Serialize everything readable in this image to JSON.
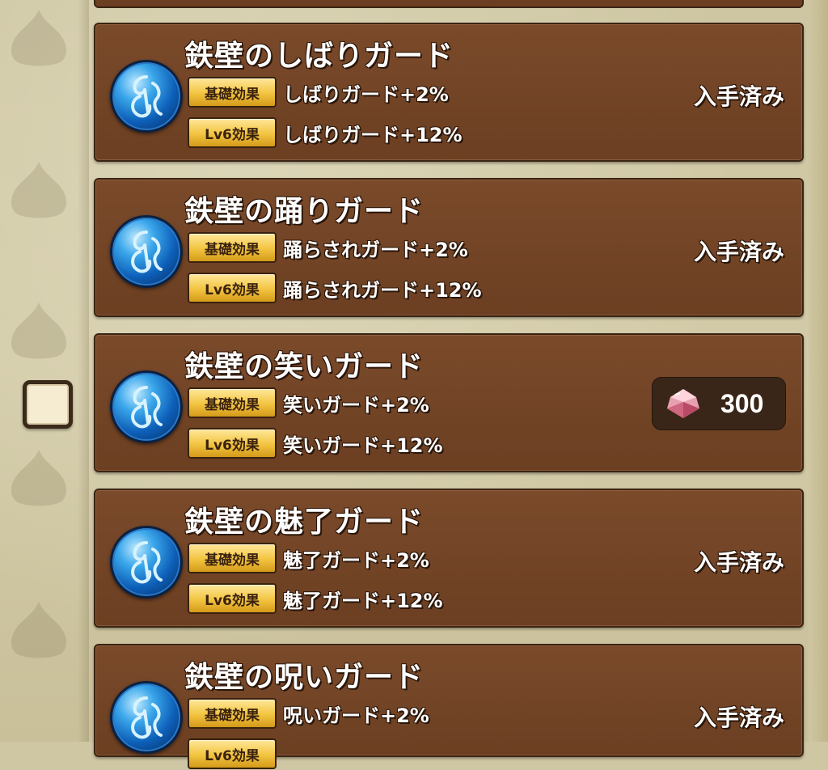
{
  "skills": [
    {
      "title": "鉄壁のしばりガード",
      "base_tag": "基礎効果",
      "base_effect": "しばりガード+2%",
      "lv_tag": "Lv6効果",
      "lv_effect": "しばりガード+12%",
      "status": "入手済み",
      "acquired": true,
      "icon": "guard-orb-icon"
    },
    {
      "title": "鉄壁の踊りガード",
      "base_tag": "基礎効果",
      "base_effect": "踊らされガード+2%",
      "lv_tag": "Lv6効果",
      "lv_effect": "踊らされガード+12%",
      "status": "入手済み",
      "acquired": true,
      "icon": "guard-orb-icon"
    },
    {
      "title": "鉄壁の笑いガード",
      "base_tag": "基礎効果",
      "base_effect": "笑いガード+2%",
      "lv_tag": "Lv6効果",
      "lv_effect": "笑いガード+12%",
      "acquired": false,
      "price": "300",
      "price_icon": "gem-icon",
      "icon": "guard-orb-icon"
    },
    {
      "title": "鉄壁の魅了ガード",
      "base_tag": "基礎効果",
      "base_effect": "魅了ガード+2%",
      "lv_tag": "Lv6効果",
      "lv_effect": "魅了ガード+12%",
      "status": "入手済み",
      "acquired": true,
      "icon": "guard-orb-icon"
    },
    {
      "title": "鉄壁の呪いガード",
      "base_tag": "基礎効果",
      "base_effect": "呪いガード+2%",
      "lv_tag": "Lv6効果",
      "status": "入手済み",
      "acquired": true,
      "icon": "guard-orb-icon"
    }
  ],
  "colors": {
    "card_bg": "#6c3f22",
    "tag_gold": "#f2c440",
    "orb_blue": "#0d5fb8",
    "parchment": "#cfc7a3"
  },
  "checkbox_checked": false
}
